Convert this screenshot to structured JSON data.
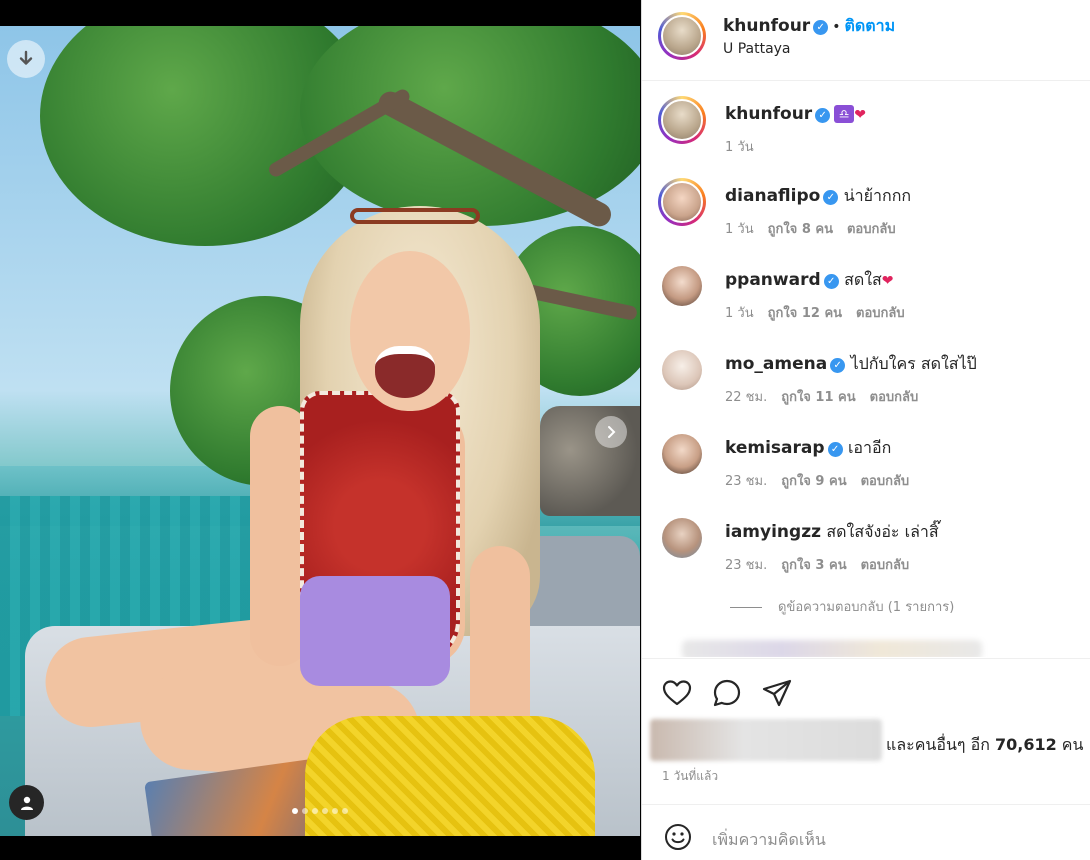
{
  "post": {
    "author": "khunfour",
    "follow_label": "ติดตาม",
    "separator": "•",
    "location": "U Pattaya",
    "verified_glyph": "✓",
    "image_slide_index": 1,
    "image_slide_count": 6
  },
  "caption": {
    "username": "khunfour",
    "emoji_libra": "♎",
    "emoji_heart": "❤",
    "time": "1 วัน"
  },
  "comments": [
    {
      "username": "dianaflipo",
      "text": "น่าย้ากกก",
      "time": "1 วัน",
      "likes": "ถูกใจ 8 คน",
      "reply": "ตอบกลับ"
    },
    {
      "username": "ppanward",
      "text": "สดใส",
      "heart": "❤",
      "time": "1 วัน",
      "likes": "ถูกใจ 12 คน",
      "reply": "ตอบกลับ"
    },
    {
      "username": "mo_amena",
      "text": "ไปกับใคร สดใสไป๊",
      "time": "22 ชม.",
      "likes": "ถูกใจ 11 คน",
      "reply": "ตอบกลับ"
    },
    {
      "username": "kemisarap",
      "text": "เอาอีก",
      "time": "23 ชม.",
      "likes": "ถูกใจ 9 คน",
      "reply": "ตอบกลับ"
    },
    {
      "username": "iamyingzz",
      "text": "สดใสจังอ่ะ เล่าสิ๊",
      "time": "23 ชม.",
      "likes": "ถูกใจ 3 คน",
      "reply": "ตอบกลับ"
    }
  ],
  "view_replies": "ดูข้อความตอบกลับ (1 รายการ)",
  "likes_summary": {
    "prefix": "และคนอื่นๆ อีก ",
    "count": "70,612",
    "suffix": " คน"
  },
  "posted_ago": "1 วันที่แล้ว",
  "composer": {
    "placeholder": "เพิ่มความคิดเห็น"
  },
  "icons": [
    "download-icon",
    "user-tag-icon",
    "next-arrow-icon",
    "heart-icon",
    "comment-icon",
    "share-icon",
    "emoji-icon",
    "verified-badge-icon"
  ],
  "colors": {
    "link_blue": "#0095f6",
    "verified_blue": "#3897f0",
    "muted_gray": "#8e8e8e",
    "text": "#262626"
  }
}
